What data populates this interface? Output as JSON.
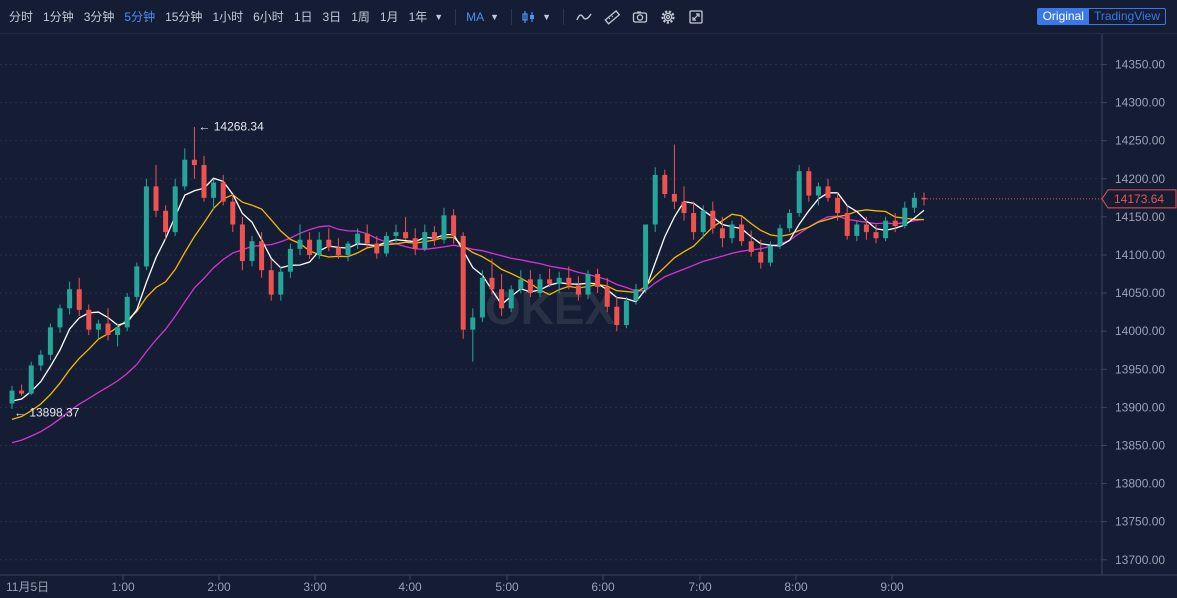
{
  "toolbar": {
    "timeframes": [
      "分时",
      "1分钟",
      "3分钟",
      "5分钟",
      "15分钟",
      "1小时",
      "6小时",
      "1日",
      "3日",
      "1周",
      "1月",
      "1年"
    ],
    "active_timeframe": "5分钟",
    "indicator": "MA",
    "icons": [
      "chevron-down-icon",
      "candlestick-icon",
      "line-style-icon",
      "ruler-icon",
      "camera-icon",
      "gear-icon",
      "fullscreen-icon"
    ],
    "view_original": "Original",
    "view_tradingview": "TradingView"
  },
  "watermark": "OKEX",
  "chart_data": {
    "type": "candlestick",
    "price_axis": {
      "ticks": [
        "14350.00",
        "14300.00",
        "14250.00",
        "14200.00",
        "14150.00",
        "14100.00",
        "14050.00",
        "14000.00",
        "13950.00",
        "13900.00",
        "13850.00",
        "13800.00",
        "13750.00",
        "13700.00"
      ],
      "range": [
        13680,
        14390
      ]
    },
    "time_axis": {
      "ticks": [
        "11月5日",
        "1:00",
        "2:00",
        "3:00",
        "4:00",
        "5:00",
        "6:00",
        "7:00",
        "8:00",
        "9:00"
      ],
      "interval_minutes": 5
    },
    "annotations": {
      "high": "14268.34",
      "low": "13898.37",
      "last_price": "14173.64"
    },
    "colors": {
      "up": "#26a69a",
      "down": "#ef5350",
      "ma_fast": "#ffffff",
      "ma_mid": "#f5b800",
      "ma_slow": "#d633d6",
      "last_price": "#ef5350"
    },
    "candles": [
      [
        13905,
        13928,
        13898,
        13922
      ],
      [
        13922,
        13930,
        13915,
        13918
      ],
      [
        13918,
        13960,
        13916,
        13955
      ],
      [
        13955,
        13975,
        13948,
        13969
      ],
      [
        13969,
        14010,
        13962,
        14005
      ],
      [
        14005,
        14035,
        13998,
        14030
      ],
      [
        14030,
        14065,
        14022,
        14055
      ],
      [
        14055,
        14070,
        14020,
        14028
      ],
      [
        14028,
        14035,
        13995,
        14002
      ],
      [
        14002,
        14015,
        13990,
        14010
      ],
      [
        14010,
        14030,
        13988,
        13995
      ],
      [
        13995,
        14010,
        13980,
        14005
      ],
      [
        14005,
        14050,
        14000,
        14045
      ],
      [
        14045,
        14090,
        14040,
        14085
      ],
      [
        14085,
        14200,
        14080,
        14190
      ],
      [
        14190,
        14218,
        14150,
        14158
      ],
      [
        14158,
        14165,
        14120,
        14130
      ],
      [
        14130,
        14200,
        14125,
        14190
      ],
      [
        14190,
        14240,
        14185,
        14225
      ],
      [
        14225,
        14268,
        14200,
        14218
      ],
      [
        14218,
        14230,
        14170,
        14175
      ],
      [
        14175,
        14200,
        14160,
        14195
      ],
      [
        14195,
        14205,
        14165,
        14170
      ],
      [
        14170,
        14180,
        14130,
        14140
      ],
      [
        14140,
        14150,
        14080,
        14092
      ],
      [
        14092,
        14125,
        14085,
        14118
      ],
      [
        14118,
        14130,
        14070,
        14080
      ],
      [
        14080,
        14095,
        14040,
        14048
      ],
      [
        14048,
        14085,
        14040,
        14078
      ],
      [
        14078,
        14115,
        14070,
        14108
      ],
      [
        14108,
        14140,
        14100,
        14120
      ],
      [
        14120,
        14130,
        14095,
        14100
      ],
      [
        14100,
        14130,
        14095,
        14120
      ],
      [
        14120,
        14135,
        14105,
        14110
      ],
      [
        14110,
        14122,
        14095,
        14100
      ],
      [
        14100,
        14118,
        14092,
        14115
      ],
      [
        14115,
        14135,
        14108,
        14128
      ],
      [
        14128,
        14140,
        14110,
        14115
      ],
      [
        14115,
        14125,
        14095,
        14102
      ],
      [
        14102,
        14130,
        14098,
        14125
      ],
      [
        14125,
        14140,
        14115,
        14130
      ],
      [
        14130,
        14150,
        14120,
        14122
      ],
      [
        14122,
        14135,
        14100,
        14108
      ],
      [
        14108,
        14140,
        14105,
        14130
      ],
      [
        14130,
        14138,
        14112,
        14120
      ],
      [
        14120,
        14162,
        14115,
        14152
      ],
      [
        14152,
        14160,
        14115,
        14125
      ],
      [
        14125,
        14130,
        13990,
        14002
      ],
      [
        14002,
        14030,
        13960,
        14018
      ],
      [
        14018,
        14080,
        14012,
        14070
      ],
      [
        14070,
        14095,
        14048,
        14055
      ],
      [
        14055,
        14075,
        14020,
        14030
      ],
      [
        14030,
        14060,
        14025,
        14055
      ],
      [
        14055,
        14080,
        14050,
        14068
      ],
      [
        14068,
        14080,
        14045,
        14050
      ],
      [
        14050,
        14075,
        14045,
        14068
      ],
      [
        14068,
        14082,
        14058,
        14062
      ],
      [
        14062,
        14078,
        14050,
        14070
      ],
      [
        14070,
        14085,
        14055,
        14060
      ],
      [
        14060,
        14072,
        14040,
        14048
      ],
      [
        14048,
        14080,
        14042,
        14075
      ],
      [
        14075,
        14082,
        14050,
        14058
      ],
      [
        14058,
        14070,
        14025,
        14032
      ],
      [
        14032,
        14045,
        14000,
        14008
      ],
      [
        14008,
        14045,
        14004,
        14040
      ],
      [
        14040,
        14062,
        14035,
        14055
      ],
      [
        14055,
        14110,
        14050,
        14140
      ],
      [
        14140,
        14215,
        14130,
        14205
      ],
      [
        14205,
        14212,
        14175,
        14180
      ],
      [
        14180,
        14245,
        14160,
        14170
      ],
      [
        14170,
        14190,
        14145,
        14155
      ],
      [
        14155,
        14170,
        14120,
        14130
      ],
      [
        14130,
        14165,
        14122,
        14158
      ],
      [
        14158,
        14170,
        14128,
        14135
      ],
      [
        14135,
        14150,
        14110,
        14122
      ],
      [
        14122,
        14145,
        14115,
        14140
      ],
      [
        14140,
        14150,
        14112,
        14118
      ],
      [
        14118,
        14132,
        14098,
        14104
      ],
      [
        14104,
        14120,
        14082,
        14090
      ],
      [
        14090,
        14118,
        14085,
        14112
      ],
      [
        14112,
        14140,
        14108,
        14135
      ],
      [
        14135,
        14160,
        14130,
        14155
      ],
      [
        14155,
        14218,
        14150,
        14210
      ],
      [
        14210,
        14215,
        14170,
        14178
      ],
      [
        14178,
        14195,
        14165,
        14190
      ],
      [
        14190,
        14200,
        14170,
        14175
      ],
      [
        14175,
        14182,
        14145,
        14155
      ],
      [
        14155,
        14165,
        14120,
        14125
      ],
      [
        14125,
        14145,
        14118,
        14140
      ],
      [
        14140,
        14150,
        14120,
        14130
      ],
      [
        14130,
        14140,
        14115,
        14122
      ],
      [
        14122,
        14150,
        14118,
        14145
      ],
      [
        14145,
        14155,
        14130,
        14138
      ],
      [
        14138,
        14170,
        14135,
        14162
      ],
      [
        14162,
        14182,
        14155,
        14175
      ],
      [
        14175,
        14182,
        14165,
        14173
      ]
    ]
  }
}
